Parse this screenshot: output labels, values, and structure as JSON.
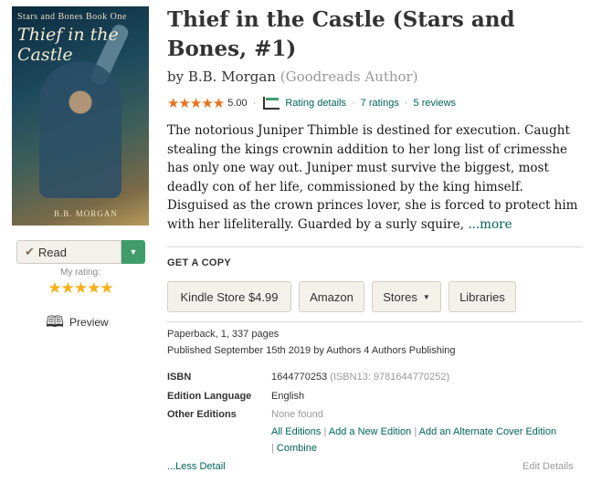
{
  "cover": {
    "series_text": "Stars and Bones Book One",
    "title_text": "Thief in the Castle",
    "author_text": "B.B. MORGAN"
  },
  "shelf": {
    "read_label": "Read",
    "my_rating_label": "My rating:",
    "my_rating_stars": "★★★★★",
    "preview_label": "Preview"
  },
  "book": {
    "title": "Thief in the Castle (Stars and Bones, #1)",
    "by": "by",
    "author": "B.B. Morgan",
    "author_badge": "(Goodreads Author)",
    "stars": "★★★★★",
    "avg_rating": "5.00",
    "rating_details": "Rating details",
    "ratings_count": "7 ratings",
    "reviews_count": "5 reviews",
    "description": "The notorious Juniper Thimble is destined for execution. Caught stealing the kings crownin addition to her long list of crimesshe has only one way out. Juniper must survive the biggest, most deadly con of her life, commissioned by the king himself. Disguised as the crown princes lover, she is forced to protect him with her lifeliterally. Guarded by a surly squire,",
    "more_link": "...more"
  },
  "get_copy": {
    "heading": "GET A COPY",
    "buttons": [
      "Kindle Store $4.99",
      "Amazon",
      "Stores",
      "Libraries"
    ]
  },
  "details": {
    "format": "Paperback, 1, 337 pages",
    "published": "Published September 15th 2019 by Authors 4 Authors Publishing",
    "isbn_label": "ISBN",
    "isbn": "1644770253",
    "isbn13": "(ISBN13: 9781644770252)",
    "language_label": "Edition Language",
    "language": "English",
    "other_editions_label": "Other Editions",
    "other_editions": "None found",
    "all_editions": "All Editions",
    "add_edition": "Add a New Edition",
    "add_cover": "Add an Alternate Cover Edition",
    "combine": "Combine",
    "separator": "|",
    "less_detail": "...Less Detail",
    "edit_details": "Edit Details"
  },
  "colors": {
    "link": "#00635d",
    "star": "#e7711b",
    "my_star": "#f8b016",
    "read_dropdown": "#409d69"
  }
}
